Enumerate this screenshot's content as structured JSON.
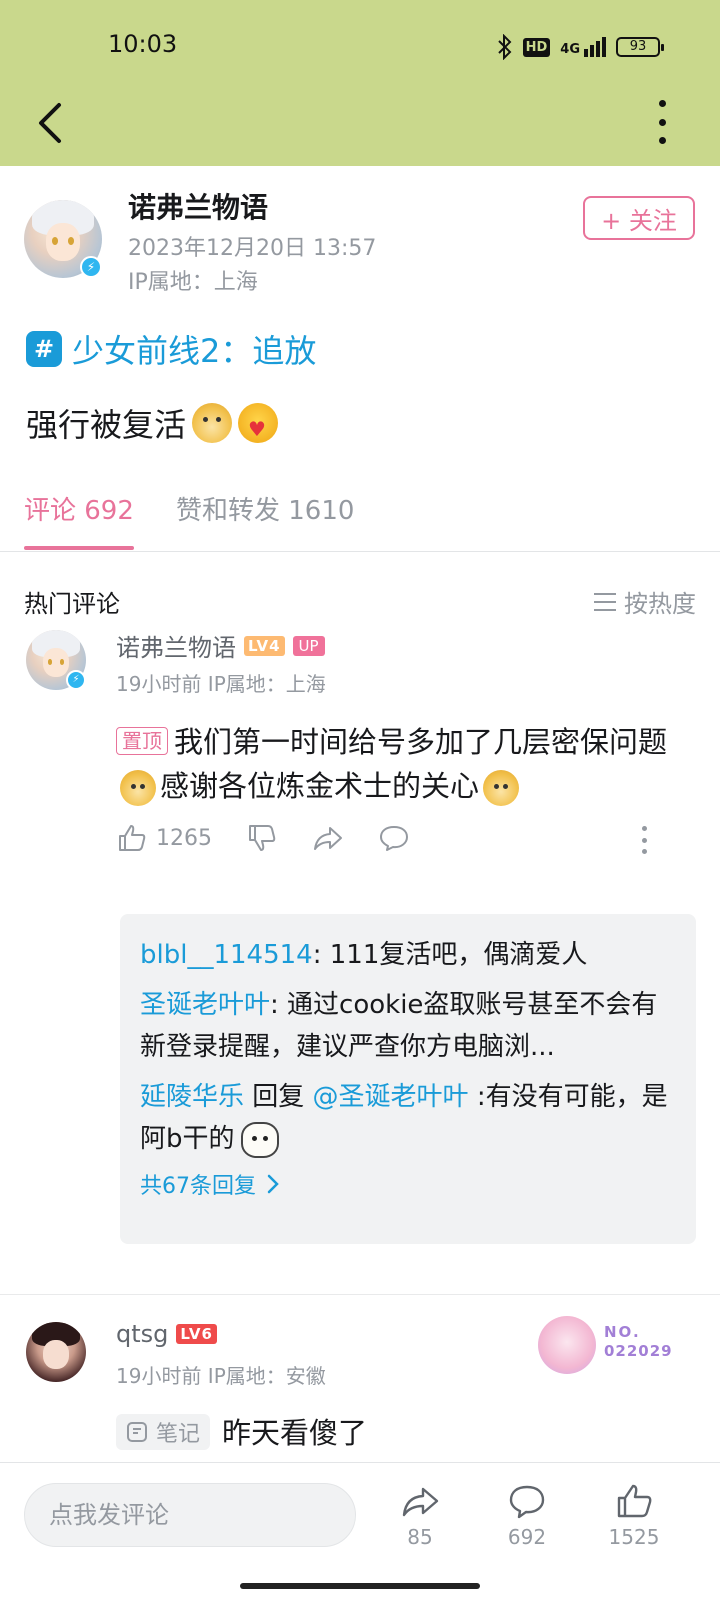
{
  "status_bar": {
    "time": "10:03",
    "hd": "HD",
    "network": "4G",
    "battery": "93"
  },
  "header": {
    "back_icon": "back-arrow-icon",
    "more_icon": "more-vertical-icon"
  },
  "post": {
    "author": "诺弗兰物语",
    "time": "2023年12月20日 13:57",
    "ip": "IP属地：上海",
    "follow_label": "+ 关注",
    "topic": "少女前线2：追放",
    "body": "强行被复活"
  },
  "tabs": {
    "comments": "评论 692",
    "reposts": "赞和转发 1610"
  },
  "hot": {
    "title": "热门评论",
    "sort_label": "按热度"
  },
  "comments": [
    {
      "name": "诺弗兰物语",
      "level": "LV4",
      "up": "UP",
      "meta": "19小时前  IP属地：上海",
      "pin": "置顶",
      "text_a": "我们第一时间给号多加了几层密保问题",
      "text_b": "感谢各位炼金术士的关心",
      "likes": "1265",
      "replies": [
        {
          "name": "blbl__114514",
          "text": ": 111复活吧，偶滴爱人"
        },
        {
          "name": "圣诞老叶叶",
          "text": ": 通过cookie盗取账号甚至不会有新登录提醒，建议严查你方电脑浏..."
        },
        {
          "name": "延陵华乐",
          "mid": " 回复 ",
          "mention": "@圣诞老叶叶",
          "text": " :有没有可能，是阿b干的"
        }
      ],
      "reply_more": "共67条回复"
    },
    {
      "name": "qtsg",
      "level": "LV6",
      "meta": "19小时前  IP属地：安徽",
      "badge_no": "NO.",
      "badge_num": "022029",
      "note": "笔记",
      "text": "昨天看傻了"
    }
  ],
  "bottom": {
    "input_placeholder": "点我发评论",
    "share_count": "85",
    "comment_count": "692",
    "like_count": "1525"
  },
  "colors": {
    "header_bg": "#c9d88c",
    "pink": "#e8739a",
    "link_blue": "#1a9bd8"
  }
}
